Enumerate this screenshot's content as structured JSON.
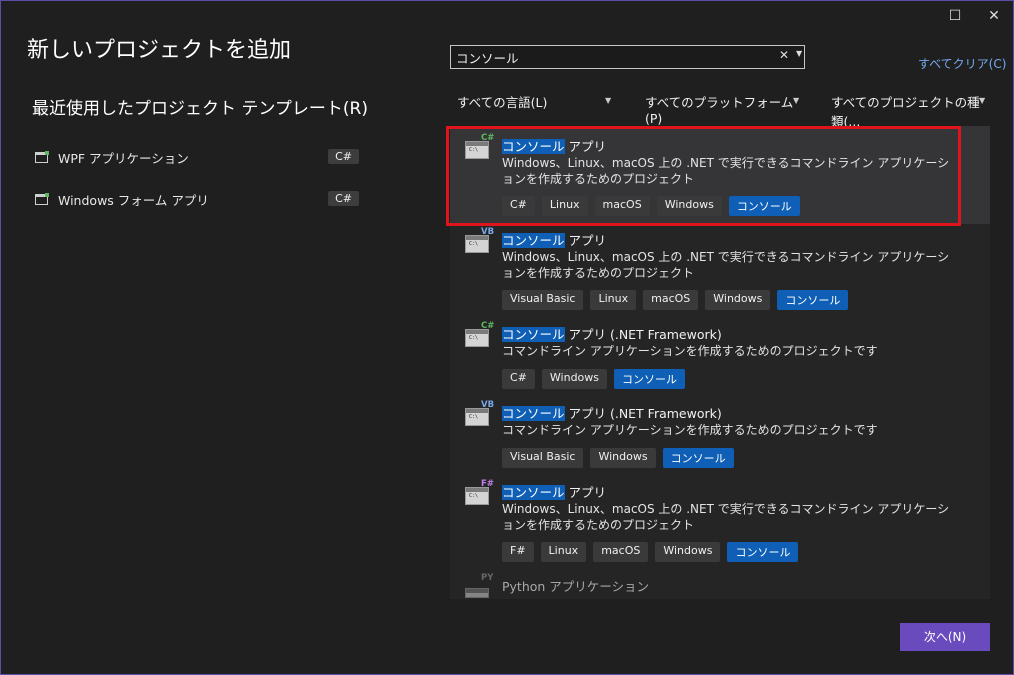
{
  "window": {
    "maximize_icon": "maximize-icon",
    "close_icon": "close-icon"
  },
  "page_title": "新しいプロジェクトを追加",
  "recent": {
    "heading": "最近使用したプロジェクト テンプレート(R)",
    "items": [
      {
        "name": "WPF アプリケーション",
        "lang": "C#"
      },
      {
        "name": "Windows フォーム アプリ",
        "lang": "C#"
      }
    ]
  },
  "search": {
    "value": "コンソール",
    "clear_icon": "clear-icon"
  },
  "clear_all": "すべてクリア(C)",
  "filters": {
    "language": "すべての言語(L)",
    "platform": "すべてのプラットフォーム(P)",
    "project_type": "すべてのプロジェクトの種類(..."
  },
  "templates": [
    {
      "lang_badge": "C#",
      "title_hl": "コンソール",
      "title_rest": " アプリ",
      "desc": "Windows、Linux、macOS 上の .NET で実行できるコマンドライン アプリケーションを作成するためのプロジェクト",
      "tags": [
        "C#",
        "Linux",
        "macOS",
        "Windows",
        "コンソール"
      ]
    },
    {
      "lang_badge": "VB",
      "title_hl": "コンソール",
      "title_rest": " アプリ",
      "desc": "Windows、Linux、macOS 上の .NET で実行できるコマンドライン アプリケーションを作成するためのプロジェクト",
      "tags": [
        "Visual Basic",
        "Linux",
        "macOS",
        "Windows",
        "コンソール"
      ]
    },
    {
      "lang_badge": "C#",
      "title_hl": "コンソール",
      "title_rest": " アプリ (.NET Framework)",
      "desc": "コマンドライン アプリケーションを作成するためのプロジェクトです",
      "tags": [
        "C#",
        "Windows",
        "コンソール"
      ]
    },
    {
      "lang_badge": "VB",
      "title_hl": "コンソール",
      "title_rest": " アプリ (.NET Framework)",
      "desc": "コマンドライン アプリケーションを作成するためのプロジェクトです",
      "tags": [
        "Visual Basic",
        "Windows",
        "コンソール"
      ]
    },
    {
      "lang_badge": "F#",
      "title_hl": "コンソール",
      "title_rest": " アプリ",
      "desc": "Windows、Linux、macOS 上の .NET で実行できるコマンドライン アプリケーションを作成するためのプロジェクト",
      "tags": [
        "F#",
        "Linux",
        "macOS",
        "Windows",
        "コンソール"
      ]
    },
    {
      "lang_badge": "PY",
      "title_hl": "",
      "title_rest": "Python アプリケーション",
      "desc": "",
      "tags": []
    }
  ],
  "next_button": "次へ(N)",
  "colors": {
    "accent": "#6a4bbd",
    "highlight": "#0e5fb5",
    "selection_box": "#e0141c",
    "link": "#75aaf0"
  }
}
